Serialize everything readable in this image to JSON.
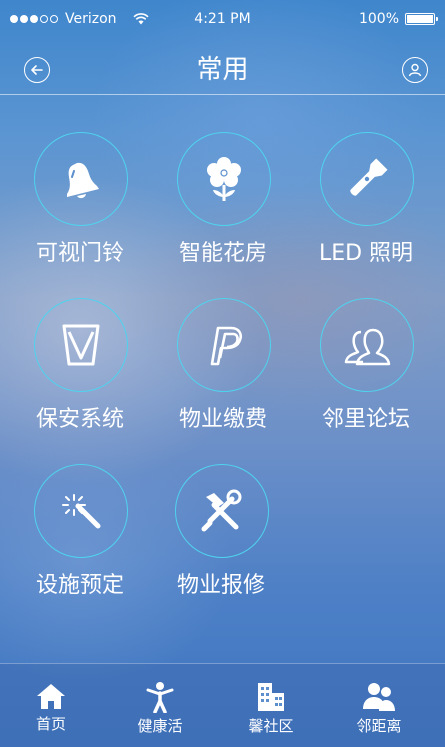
{
  "status_bar": {
    "carrier": "Verizon",
    "time": "4:21 PM",
    "battery": "100%"
  },
  "nav": {
    "title": "常用"
  },
  "grid": [
    {
      "label": "可视门铃",
      "icon": "bell-icon"
    },
    {
      "label": "智能花房",
      "icon": "flower-icon"
    },
    {
      "label": "LED 照明",
      "icon": "flashlight-icon"
    },
    {
      "label": "保安系统",
      "icon": "shield-icon"
    },
    {
      "label": "物业缴费",
      "icon": "paypal-icon"
    },
    {
      "label": "邻里论坛",
      "icon": "users-icon"
    },
    {
      "label": "设施预定",
      "icon": "magic-wand-icon"
    },
    {
      "label": "物业报修",
      "icon": "tools-icon"
    }
  ],
  "tabs": [
    {
      "label": "首页",
      "icon": "home-icon"
    },
    {
      "label": "健康活",
      "icon": "person-icon"
    },
    {
      "label": "馨社区",
      "icon": "building-icon"
    },
    {
      "label": "邻距离",
      "icon": "neighbors-icon"
    }
  ]
}
